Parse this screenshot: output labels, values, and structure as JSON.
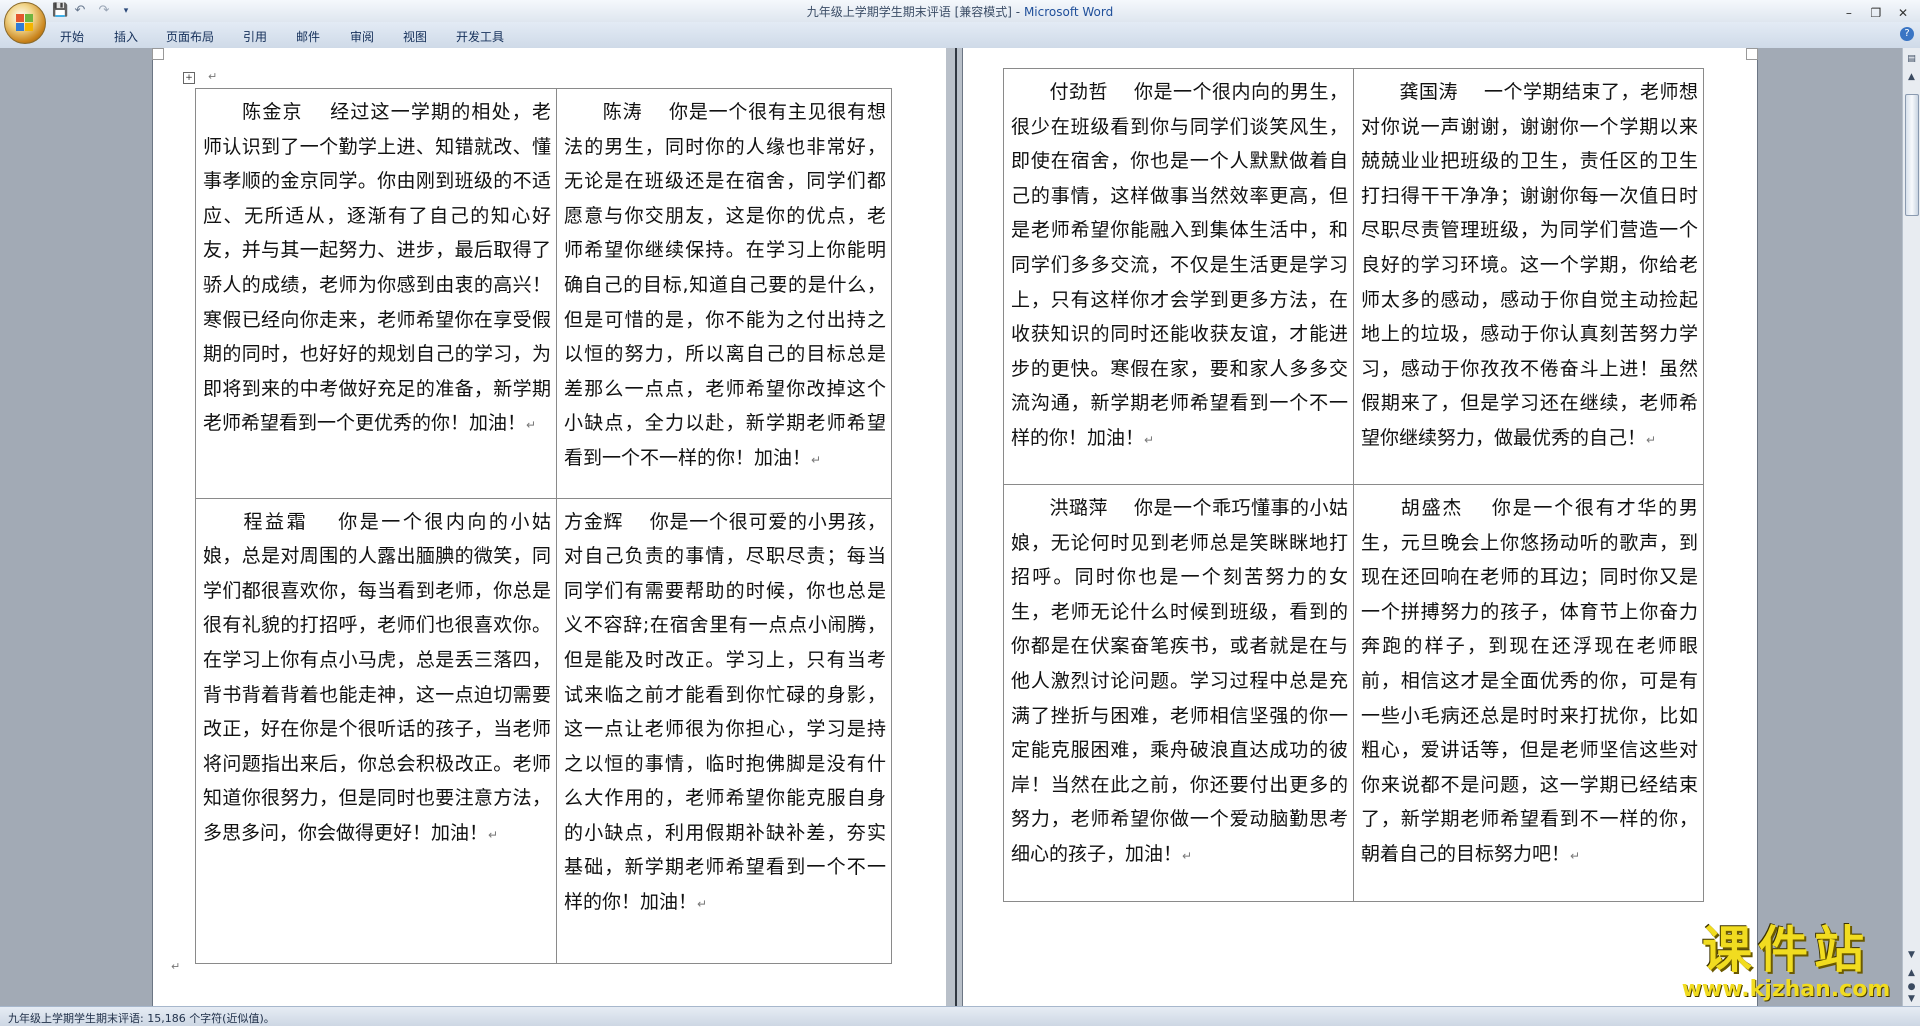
{
  "window": {
    "title_doc": "九年级上学期学生期末评语 [兼容模式]",
    "title_app": "Microsoft Word"
  },
  "ribbon": {
    "tabs": [
      "开始",
      "插入",
      "页面布局",
      "引用",
      "邮件",
      "审阅",
      "视图",
      "开发工具"
    ]
  },
  "page1": {
    "cells": [
      {
        "name": "陈金京",
        "text": "经过这一学期的相处，老师认识到了一个勤学上进、知错就改、懂事孝顺的金京同学。你由刚到班级的不适应、无所适从，逐渐有了自己的知心好友，并与其一起努力、进步，最后取得了骄人的成绩，老师为你感到由衷的高兴！寒假已经向你走来，老师希望你在享受假期的同时，也好好的规划自己的学习，为即将到来的中考做好充足的准备，新学期老师希望看到一个更优秀的你！加油！"
      },
      {
        "name": "陈涛",
        "text": "你是一个很有主见很有想法的男生，同时你的人缘也非常好，无论是在班级还是在宿舍，同学们都愿意与你交朋友，这是你的优点，老师希望你继续保持。在学习上你能明确自己的目标,知道自己要的是什么，但是可惜的是，你不能为之付出持之以恒的努力，所以离自己的目标总是差那么一点点，老师希望你改掉这个小缺点，全力以赴，新学期老师希望看到一个不一样的你！加油！"
      },
      {
        "name": "程益霜",
        "text": "你是一个很内向的小姑娘，总是对周围的人露出腼腆的微笑，同学们都很喜欢你，每当看到老师，你总是很有礼貌的打招呼，老师们也很喜欢你。在学习上你有点小马虎，总是丢三落四，背书背着背着也能走神，这一点迫切需要改正，好在你是个很听话的孩子，当老师将问题指出来后，你总会积极改正。老师知道你很努力，但是同时也要注意方法，多思多问，你会做得更好！加油！"
      },
      {
        "name": "方金辉",
        "text": "你是一个很可爱的小男孩，对自己负责的事情，尽职尽责；每当同学们有需要帮助的时候，你也总是义不容辞;在宿舍里有一点点小闹腾，但是能及时改正。学习上，只有当考试来临之前才能看到你忙碌的身影，这一点让老师很为你担心，学习是持之以恒的事情，临时抱佛脚是没有什么大作用的，老师希望你能克服自身的小缺点，利用假期补缺补差，夯实基础，新学期老师希望看到一个不一样的你！加油！"
      }
    ]
  },
  "page2": {
    "cells": [
      {
        "name": "付劲哲",
        "text": "你是一个很内向的男生，很少在班级看到你与同学们谈笑风生，即使在宿舍，你也是一个人默默做着自己的事情，这样做事当然效率更高，但是老师希望你能融入到集体生活中，和同学们多多交流，不仅是生活更是学习上，只有这样你才会学到更多方法，在收获知识的同时还能收获友谊，才能进步的更快。寒假在家，要和家人多多交流沟通，新学期老师希望看到一个不一样的你！加油！"
      },
      {
        "name": "龚国涛",
        "text": "一个学期结束了，老师想对你说一声谢谢，谢谢你一个学期以来兢兢业业把班级的卫生，责任区的卫生打扫得干干净净；谢谢你每一次值日时尽职尽责管理班级，为同学们营造一个良好的学习环境。这一个学期，你给老师太多的感动，感动于你自觉主动捡起地上的垃圾，感动于你认真刻苦努力学习，感动于你孜孜不倦奋斗上进！虽然假期来了，但是学习还在继续，老师希望你继续努力，做最优秀的自己！"
      },
      {
        "name": "洪璐萍",
        "text": "你是一个乖巧懂事的小姑娘，无论何时见到老师总是笑眯眯地打招呼。同时你也是一个刻苦努力的女生，老师无论什么时候到班级，看到的你都是在伏案奋笔疾书，或者就是在与他人激烈讨论问题。学习过程中总是充满了挫折与困难，老师相信坚强的你一定能克服困难，乘舟破浪直达成功的彼岸！当然在此之前，你还要付出更多的努力，老师希望你做一个爱动脑勤思考细心的孩子，加油！"
      },
      {
        "name": "胡盛杰",
        "text": "你是一个很有才华的男生，元旦晚会上你悠扬动听的歌声，到现在还回响在老师的耳边；同时你又是一个拼搏努力的孩子，体育节上你奋力奔跑的样子，到现在还浮现在老师眼前，相信这才是全面优秀的你，可是有一些小毛病还总是时时来打扰你，比如粗心，爱讲话等，但是老师坚信这些对你来说都不是问题，这一学期已经结束了，新学期老师希望看到不一样的你，朝着自己的目标努力吧！"
      }
    ]
  },
  "statusbar": {
    "text": "九年级上学期学生期末评语: 15,186 个字符(近似值)。"
  },
  "watermark": {
    "title": "课件站",
    "url": "www.kjzhan.com"
  },
  "marks": {
    "return": "↵"
  }
}
